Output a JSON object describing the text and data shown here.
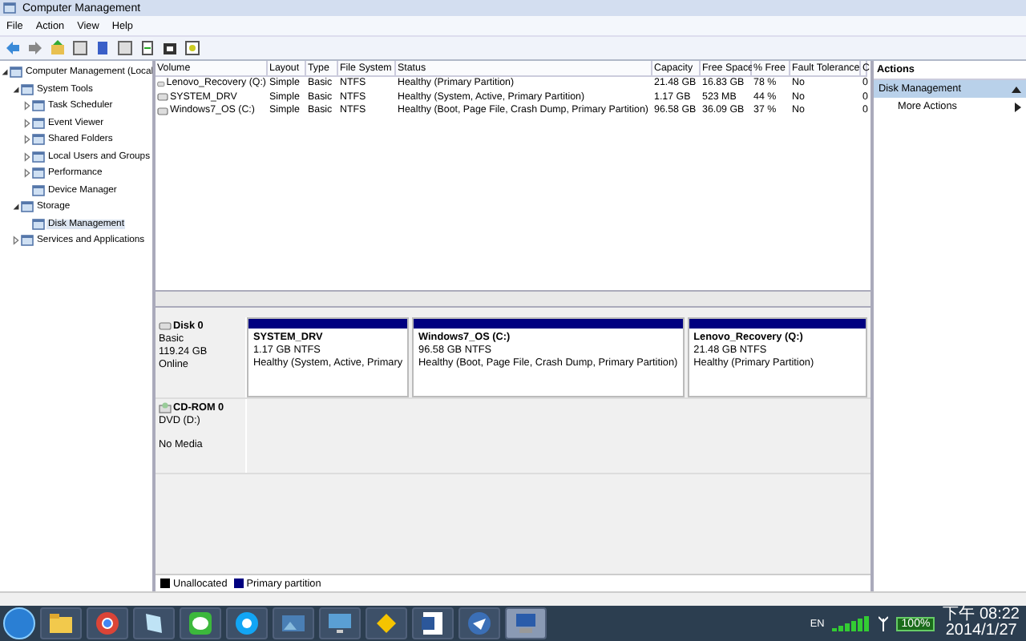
{
  "window": {
    "title": "Computer Management"
  },
  "menu": [
    "File",
    "Action",
    "View",
    "Help"
  ],
  "tree": [
    {
      "label": "Computer Management (Local",
      "expanded": true,
      "selected": false,
      "children": [
        {
          "label": "System Tools",
          "expanded": true,
          "selected": false,
          "children": [
            {
              "label": "Task Scheduler",
              "expanded": false,
              "selected": false
            },
            {
              "label": "Event Viewer",
              "expanded": false,
              "selected": false
            },
            {
              "label": "Shared Folders",
              "expanded": false,
              "selected": false
            },
            {
              "label": "Local Users and Groups",
              "expanded": false,
              "selected": false
            },
            {
              "label": "Performance",
              "expanded": false,
              "selected": false
            },
            {
              "label": "Device Manager",
              "selected": false
            }
          ]
        },
        {
          "label": "Storage",
          "expanded": true,
          "selected": false,
          "children": [
            {
              "label": "Disk Management",
              "selected": true
            }
          ]
        },
        {
          "label": "Services and Applications",
          "expanded": false,
          "selected": false
        }
      ]
    }
  ],
  "table": {
    "columns": [
      "Volume",
      "Layout",
      "Type",
      "File System",
      "Status",
      "Capacity",
      "Free Space",
      "% Free",
      "Fault Tolerance",
      "C"
    ],
    "rows": [
      [
        "Lenovo_Recovery (Q:)",
        "Simple",
        "Basic",
        "NTFS",
        "Healthy (Primary Partition)",
        "21.48 GB",
        "16.83 GB",
        "78 %",
        "No",
        "0"
      ],
      [
        "SYSTEM_DRV",
        "Simple",
        "Basic",
        "NTFS",
        "Healthy (System, Active, Primary Partition)",
        "1.17 GB",
        "523 MB",
        "44 %",
        "No",
        "0"
      ],
      [
        "Windows7_OS (C:)",
        "Simple",
        "Basic",
        "NTFS",
        "Healthy (Boot, Page File, Crash Dump, Primary Partition)",
        "96.58 GB",
        "36.09 GB",
        "37 %",
        "No",
        "0"
      ]
    ]
  },
  "disks": [
    {
      "kind": "disk",
      "name": "Disk 0",
      "lines": [
        "Basic",
        "119.24 GB",
        "Online"
      ],
      "partitions": [
        {
          "name": "SYSTEM_DRV",
          "size": "1.17 GB NTFS",
          "status": "Healthy (System, Active, Primary",
          "color": "#000080"
        },
        {
          "name": "Windows7_OS  (C:)",
          "size": "96.58 GB NTFS",
          "status": "Healthy (Boot, Page File, Crash Dump, Primary Partition)",
          "color": "#000080"
        },
        {
          "name": "Lenovo_Recovery  (Q:)",
          "size": "21.48 GB NTFS",
          "status": "Healthy (Primary Partition)",
          "color": "#000080"
        }
      ]
    },
    {
      "kind": "cdrom",
      "name": "CD-ROM 0",
      "lines": [
        "DVD (D:)",
        "No Media"
      ]
    }
  ],
  "legend": [
    {
      "label": "Unallocated",
      "color": "#000000"
    },
    {
      "label": "Primary partition",
      "color": "#000080"
    }
  ],
  "actions": {
    "title": "Actions",
    "section": {
      "label": "Disk Management",
      "expanded": true
    },
    "items": [
      "More Actions"
    ]
  },
  "taskbar": {
    "apps": [
      {
        "kind": "folder",
        "selected": false
      },
      {
        "kind": "browser",
        "selected": false
      },
      {
        "kind": "notebook",
        "selected": false
      },
      {
        "kind": "chat",
        "selected": false
      },
      {
        "kind": "call",
        "selected": false
      },
      {
        "kind": "picture",
        "selected": false
      },
      {
        "kind": "monitor",
        "selected": false
      },
      {
        "kind": "tag",
        "selected": false
      },
      {
        "kind": "document",
        "selected": false
      },
      {
        "kind": "mail",
        "selected": false
      },
      {
        "kind": "computer",
        "selected": true
      }
    ],
    "language": "EN",
    "battery": "100%",
    "time": "下午 08:22",
    "date": "2014/1/27"
  }
}
